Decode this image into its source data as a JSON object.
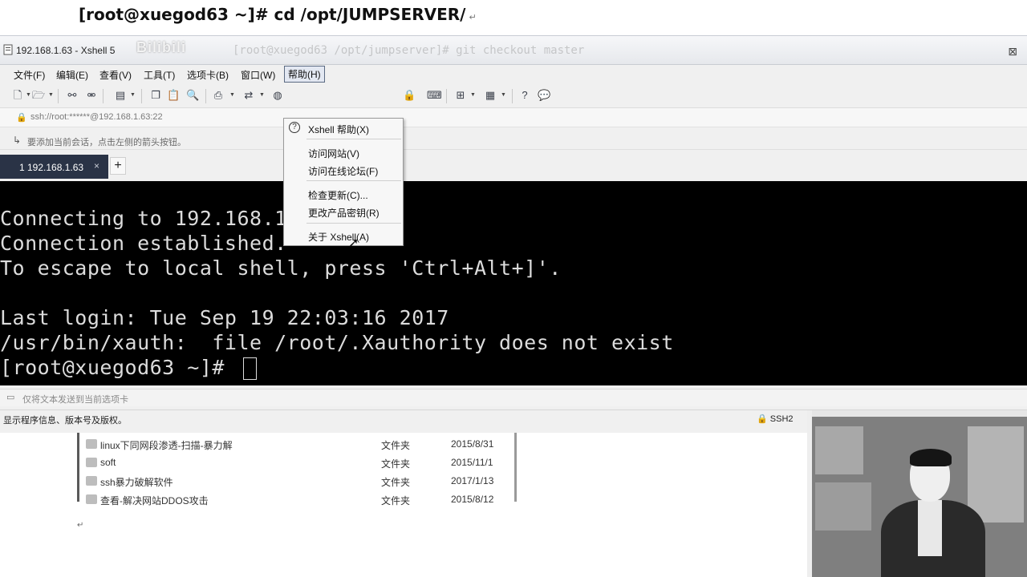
{
  "doc": {
    "command": "[root@xuegod63 ~]# cd /opt/JUMPSERVER/",
    "return_mark": "↵"
  },
  "window": {
    "title": "192.168.1.63 - Xshell 5",
    "watermark": "Bilibili",
    "background_command": "[root@xuegod63 /opt/jumpserver]# git checkout master"
  },
  "menubar": {
    "items": [
      "文件(F)",
      "编辑(E)",
      "查看(V)",
      "工具(T)",
      "选项卡(B)",
      "窗口(W)",
      "帮助(H)"
    ],
    "active": "帮助(H)"
  },
  "toolbar": {
    "icons": [
      "new-session-icon",
      "open-folder-icon",
      "connect-icon",
      "disconnect-icon",
      "properties-icon",
      "copy-icon",
      "paste-icon",
      "find-icon",
      "print-icon",
      "transfer-icon",
      "globe-icon",
      "lock-icon",
      "keyboard-icon",
      "add-icon",
      "layout-icon",
      "help-icon",
      "chat-icon"
    ]
  },
  "address": {
    "text": "ssh://root:******@192.168.1.63:22"
  },
  "hint": {
    "text": "要添加当前会话，点击左侧的箭头按钮。"
  },
  "tabs": [
    {
      "label": "1 192.168.1.63",
      "close": "×"
    }
  ],
  "tab_add": "+",
  "terminal": {
    "lines": [
      "Connecting to 192.168.1.63:22...",
      "Connection established.",
      "To escape to local shell, press 'Ctrl+Alt+]'.",
      "",
      "Last login: Tue Sep 19 22:03:16 2017",
      "/usr/bin/xauth:  file /root/.Xauthority does not exist",
      "[root@xuegod63 ~]# "
    ],
    "colors": {
      "background": "#000000",
      "foreground": "#dcdcdc"
    }
  },
  "help_menu": {
    "items": [
      {
        "label": "Xshell 帮助(X)",
        "icon": "help-circle-icon"
      },
      {
        "label": "访问网站(V)"
      },
      {
        "label": "访问在线论坛(F)"
      },
      {
        "label": "检查更新(C)..."
      },
      {
        "label": "更改产品密钥(R)"
      },
      {
        "label": "关于 Xshell(A)"
      }
    ]
  },
  "sendbar": {
    "text": "仅将文本发送到当前选项卡"
  },
  "statusbar": {
    "message": "显示程序信息、版本号及版权。",
    "protocol": "SSH2"
  },
  "explorer": {
    "rows": [
      {
        "name": "linux下同网段渗透-扫描-暴力解",
        "type": "文件夹",
        "date": "2015/8/31"
      },
      {
        "name": "soft",
        "type": "文件夹",
        "date": "2015/11/1"
      },
      {
        "name": "ssh暴力破解软件",
        "type": "文件夹",
        "date": "2017/1/13"
      },
      {
        "name": "查看-解决网站DDOS攻击",
        "type": "文件夹",
        "date": "2015/8/12"
      }
    ]
  },
  "page_return": "↵"
}
